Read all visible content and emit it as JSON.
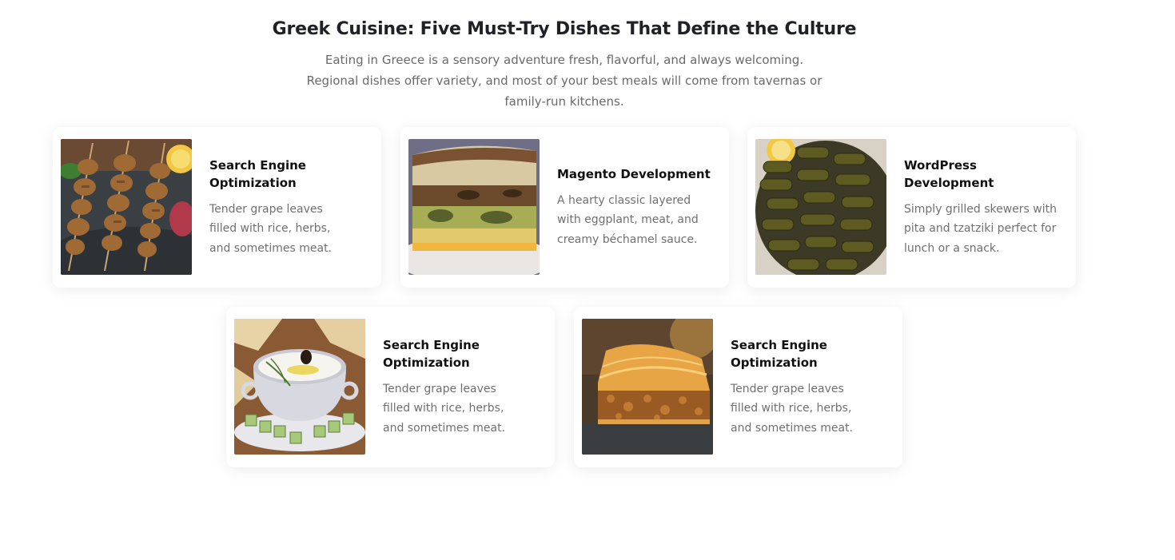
{
  "header": {
    "title": "Greek Cuisine: Five Must-Try Dishes That Define the Culture",
    "description": "Eating in Greece is a sensory adventure fresh, flavorful, and always welcoming. Regional dishes offer variety, and most of your best meals will come from tavernas or family-run kitchens."
  },
  "cards": [
    {
      "title": "Search Engine Optimization",
      "description": "Tender grape leaves filled with rice, herbs, and sometimes meat.",
      "image": "souvlaki-skewers-photo"
    },
    {
      "title": "Magento Development",
      "description": "A hearty classic layered with eggplant, meat, and creamy béchamel sauce.",
      "image": "moussaka-photo"
    },
    {
      "title": "WordPress Development",
      "description": "Simply grilled skewers with pita and tzatziki perfect for lunch or a snack.",
      "image": "dolmades-photo"
    },
    {
      "title": "Search Engine Optimization",
      "description": "Tender grape leaves filled with rice, herbs, and sometimes meat.",
      "image": "tzatziki-photo"
    },
    {
      "title": "Search Engine Optimization",
      "description": "Tender grape leaves filled with rice, herbs, and sometimes meat.",
      "image": "baklava-photo"
    }
  ]
}
